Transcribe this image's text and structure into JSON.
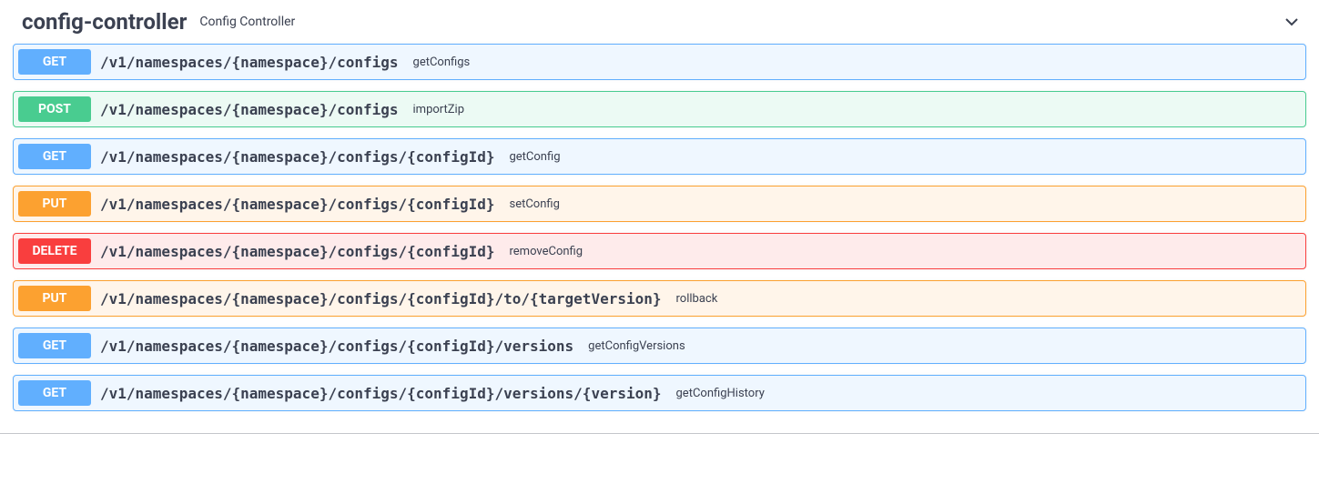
{
  "tag": {
    "name": "config-controller",
    "description": "Config Controller"
  },
  "operations": [
    {
      "method": "GET",
      "path": "/v1/namespaces/{namespace}/configs",
      "summary": "getConfigs"
    },
    {
      "method": "POST",
      "path": "/v1/namespaces/{namespace}/configs",
      "summary": "importZip"
    },
    {
      "method": "GET",
      "path": "/v1/namespaces/{namespace}/configs/{configId}",
      "summary": "getConfig"
    },
    {
      "method": "PUT",
      "path": "/v1/namespaces/{namespace}/configs/{configId}",
      "summary": "setConfig"
    },
    {
      "method": "DELETE",
      "path": "/v1/namespaces/{namespace}/configs/{configId}",
      "summary": "removeConfig"
    },
    {
      "method": "PUT",
      "path": "/v1/namespaces/{namespace}/configs/{configId}/to/{targetVersion}",
      "summary": "rollback"
    },
    {
      "method": "GET",
      "path": "/v1/namespaces/{namespace}/configs/{configId}/versions",
      "summary": "getConfigVersions"
    },
    {
      "method": "GET",
      "path": "/v1/namespaces/{namespace}/configs/{configId}/versions/{version}",
      "summary": "getConfigHistory"
    }
  ]
}
